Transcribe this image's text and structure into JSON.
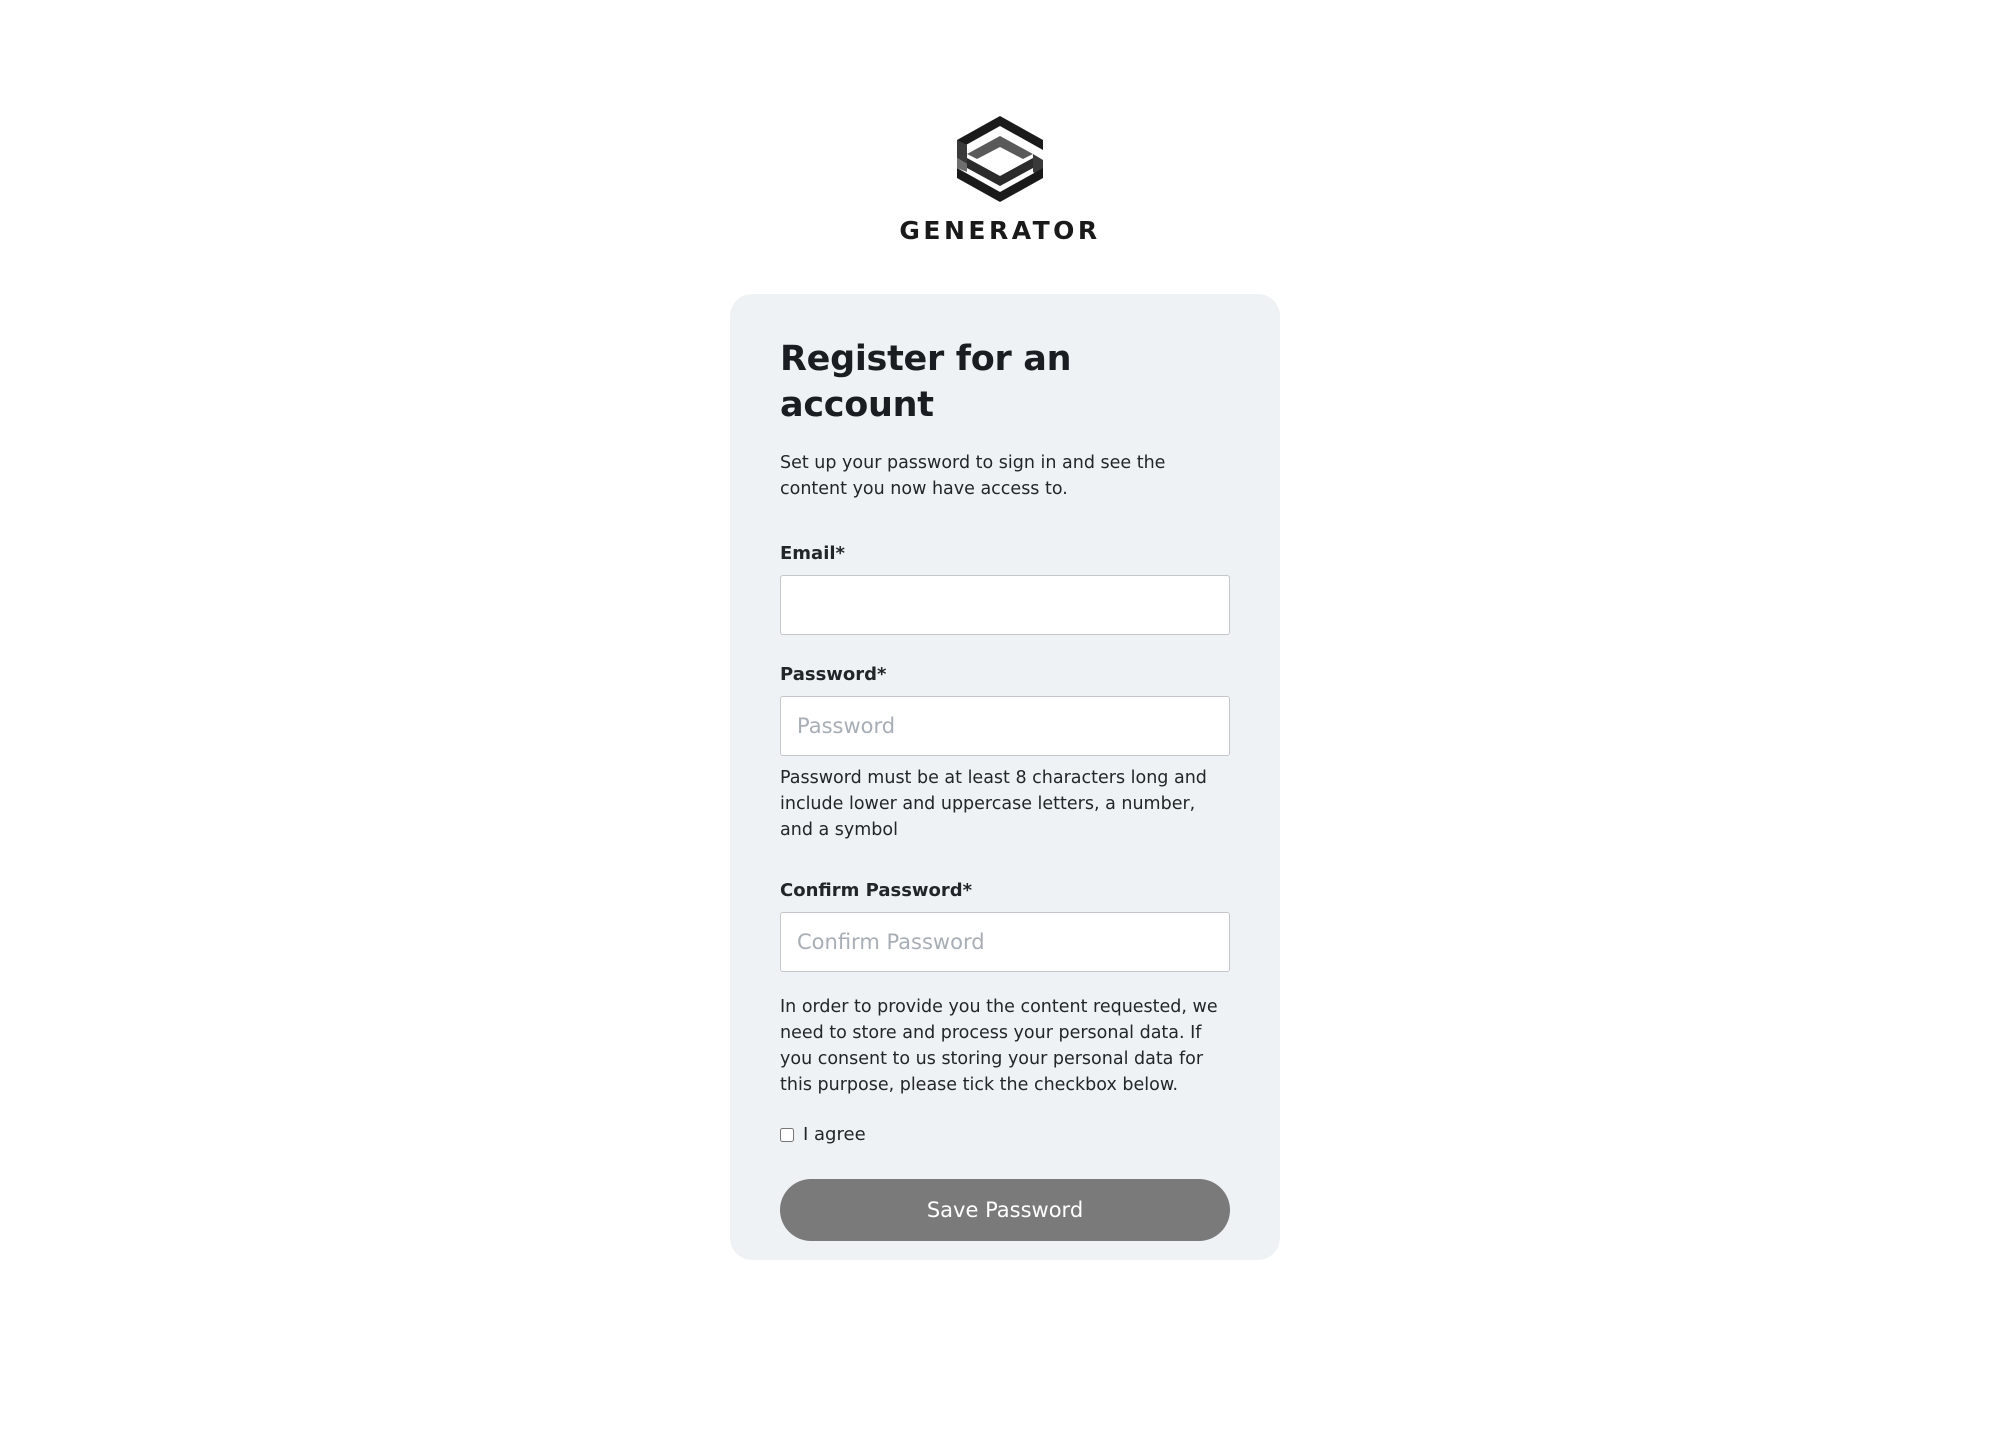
{
  "brand": {
    "name": "GENERATOR",
    "logo_icon": "generator-logo-icon",
    "logo_colors": [
      "#1a1a1a",
      "#4a4a4a",
      "#6e6e6e"
    ]
  },
  "form": {
    "title": "Register for an account",
    "intro": "Set up your password to sign in and see the content you now have access to.",
    "email": {
      "label": "Email*",
      "value": "",
      "placeholder": ""
    },
    "password": {
      "label": "Password*",
      "value": "",
      "placeholder": "Password",
      "hint": "Password must be at least 8 characters long and include lower and uppercase letters, a number, and a symbol"
    },
    "confirm_password": {
      "label": "Confirm Password*",
      "value": "",
      "placeholder": "Confirm Password"
    },
    "consent_text": "In order to provide you the content requested, we need to store and process your personal data. If you consent to us storing your personal data for this purpose, please tick the checkbox below.",
    "agree": {
      "label": "I agree",
      "checked": false
    },
    "submit_label": "Save Password"
  },
  "colors": {
    "card_background": "#eff2f4",
    "button_background": "#7a7a7a",
    "button_text": "#ffffff",
    "input_border": "#c3c7cc",
    "placeholder": "#a8aeb5"
  }
}
